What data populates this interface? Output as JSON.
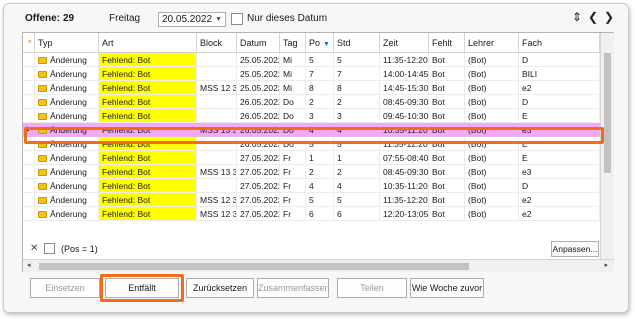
{
  "topbar": {
    "offene_label": "Offene:",
    "offene_count": "29",
    "weekday": "Freitag",
    "date_value": "20.05.2022",
    "only_date_label": "Nur dieses Datum"
  },
  "columns": [
    {
      "label": "",
      "star": "*"
    },
    {
      "label": "Typ"
    },
    {
      "label": "Art"
    },
    {
      "label": "Block"
    },
    {
      "label": "Datum"
    },
    {
      "label": "Tag"
    },
    {
      "label": "Po",
      "sorted": "desc"
    },
    {
      "label": "Std"
    },
    {
      "label": "Zeit"
    },
    {
      "label": "Fehlt"
    },
    {
      "label": "Lehrer"
    },
    {
      "label": "Fach"
    }
  ],
  "rows": [
    {
      "typ": "Änderung",
      "art": "Fehlend: Bot",
      "block": "",
      "datum": "25.05.2022",
      "tag": "Mi",
      "po": "5",
      "std": "5",
      "zeit": "11:35-12:20",
      "fehlt": "Bot",
      "lehrer": "(Bot)",
      "fach": "D",
      "highlight": "yellow"
    },
    {
      "typ": "Änderung",
      "art": "Fehlend: Bot",
      "block": "",
      "datum": "25.05.2022",
      "tag": "Mi",
      "po": "7",
      "std": "7",
      "zeit": "14:00-14:45",
      "fehlt": "Bot",
      "lehrer": "(Bot)",
      "fach": "BILI",
      "highlight": "yellow"
    },
    {
      "typ": "Änderung",
      "art": "Fehlend: Bot",
      "block": "MSS 12 30",
      "datum": "25.05.2022",
      "tag": "Mi",
      "po": "8",
      "std": "8",
      "zeit": "14:45-15:30",
      "fehlt": "Bot",
      "lehrer": "(Bot)",
      "fach": "e2",
      "highlight": "yellow"
    },
    {
      "typ": "Änderung",
      "art": "Fehlend: Bot",
      "block": "",
      "datum": "26.05.2022",
      "tag": "Do",
      "po": "2",
      "std": "2",
      "zeit": "08:45-09:30",
      "fehlt": "Bot",
      "lehrer": "(Bot)",
      "fach": "D",
      "highlight": "yellow"
    },
    {
      "typ": "Änderung",
      "art": "Fehlend: Bot",
      "block": "",
      "datum": "26.05.2022",
      "tag": "Do",
      "po": "3",
      "std": "3",
      "zeit": "09:45-10:30",
      "fehlt": "Bot",
      "lehrer": "(Bot)",
      "fach": "E",
      "highlight": "yellow"
    },
    {
      "typ": "Änderung",
      "art": "Fehlend: Bot",
      "block": "MSS 13 33",
      "datum": "26.05.2022",
      "tag": "Do",
      "po": "4",
      "std": "4",
      "zeit": "10:35-11:20",
      "fehlt": "Bot",
      "lehrer": "(Bot)",
      "fach": "e3",
      "highlight": "selected"
    },
    {
      "typ": "Änderung",
      "art": "Fehlend: Bot",
      "block": "",
      "datum": "26.05.2022",
      "tag": "Do",
      "po": "5",
      "std": "5",
      "zeit": "11:35-12:20",
      "fehlt": "Bot",
      "lehrer": "(Bot)",
      "fach": "E",
      "highlight": "yellow"
    },
    {
      "typ": "Änderung",
      "art": "Fehlend: Bot",
      "block": "",
      "datum": "27.05.2022",
      "tag": "Fr",
      "po": "1",
      "std": "1",
      "zeit": "07:55-08:40",
      "fehlt": "Bot",
      "lehrer": "(Bot)",
      "fach": "E",
      "highlight": "yellow"
    },
    {
      "typ": "Änderung",
      "art": "Fehlend: Bot",
      "block": "MSS 13 35",
      "datum": "27.05.2022",
      "tag": "Fr",
      "po": "2",
      "std": "2",
      "zeit": "08:45-09:30",
      "fehlt": "Bot",
      "lehrer": "(Bot)",
      "fach": "e3",
      "highlight": "yellow"
    },
    {
      "typ": "Änderung",
      "art": "Fehlend: Bot",
      "block": "",
      "datum": "27.05.2022",
      "tag": "Fr",
      "po": "4",
      "std": "4",
      "zeit": "10:35-11:20",
      "fehlt": "Bot",
      "lehrer": "(Bot)",
      "fach": "D",
      "highlight": "yellow"
    },
    {
      "typ": "Änderung",
      "art": "Fehlend: Bot",
      "block": "MSS 12 31",
      "datum": "27.05.2022",
      "tag": "Fr",
      "po": "5",
      "std": "5",
      "zeit": "11:35-12:20",
      "fehlt": "Bot",
      "lehrer": "(Bot)",
      "fach": "e2",
      "highlight": "yellow"
    },
    {
      "typ": "Änderung",
      "art": "Fehlend: Bot",
      "block": "MSS 12 32",
      "datum": "27.05.2022",
      "tag": "Fr",
      "po": "6",
      "std": "6",
      "zeit": "12:20-13:05",
      "fehlt": "Bot",
      "lehrer": "(Bot)",
      "fach": "e2",
      "highlight": "yellow"
    }
  ],
  "filterbar": {
    "pos_text": "(Pos = 1)",
    "customize_label": "Anpassen..."
  },
  "buttons": {
    "einsetzen": "Einsetzen",
    "entfaellt": "Entfällt",
    "zuruecksetzen": "Zurücksetzen",
    "zusammenfassen": "Zusammenfassen",
    "teilen": "Teilen",
    "wie_woche_zuvor": "Wie Woche zuvor"
  },
  "colors": {
    "yellow_highlight": "#ffff00",
    "selected_row": "#f7a8f4",
    "annotation_orange": "#f26a1b"
  },
  "icons": {
    "collapse_expand": "chevron-updown-icon",
    "prev": "chevron-left-icon",
    "next": "chevron-right-icon",
    "row_folder": "folder-icon",
    "clear_filter": "close-icon"
  }
}
